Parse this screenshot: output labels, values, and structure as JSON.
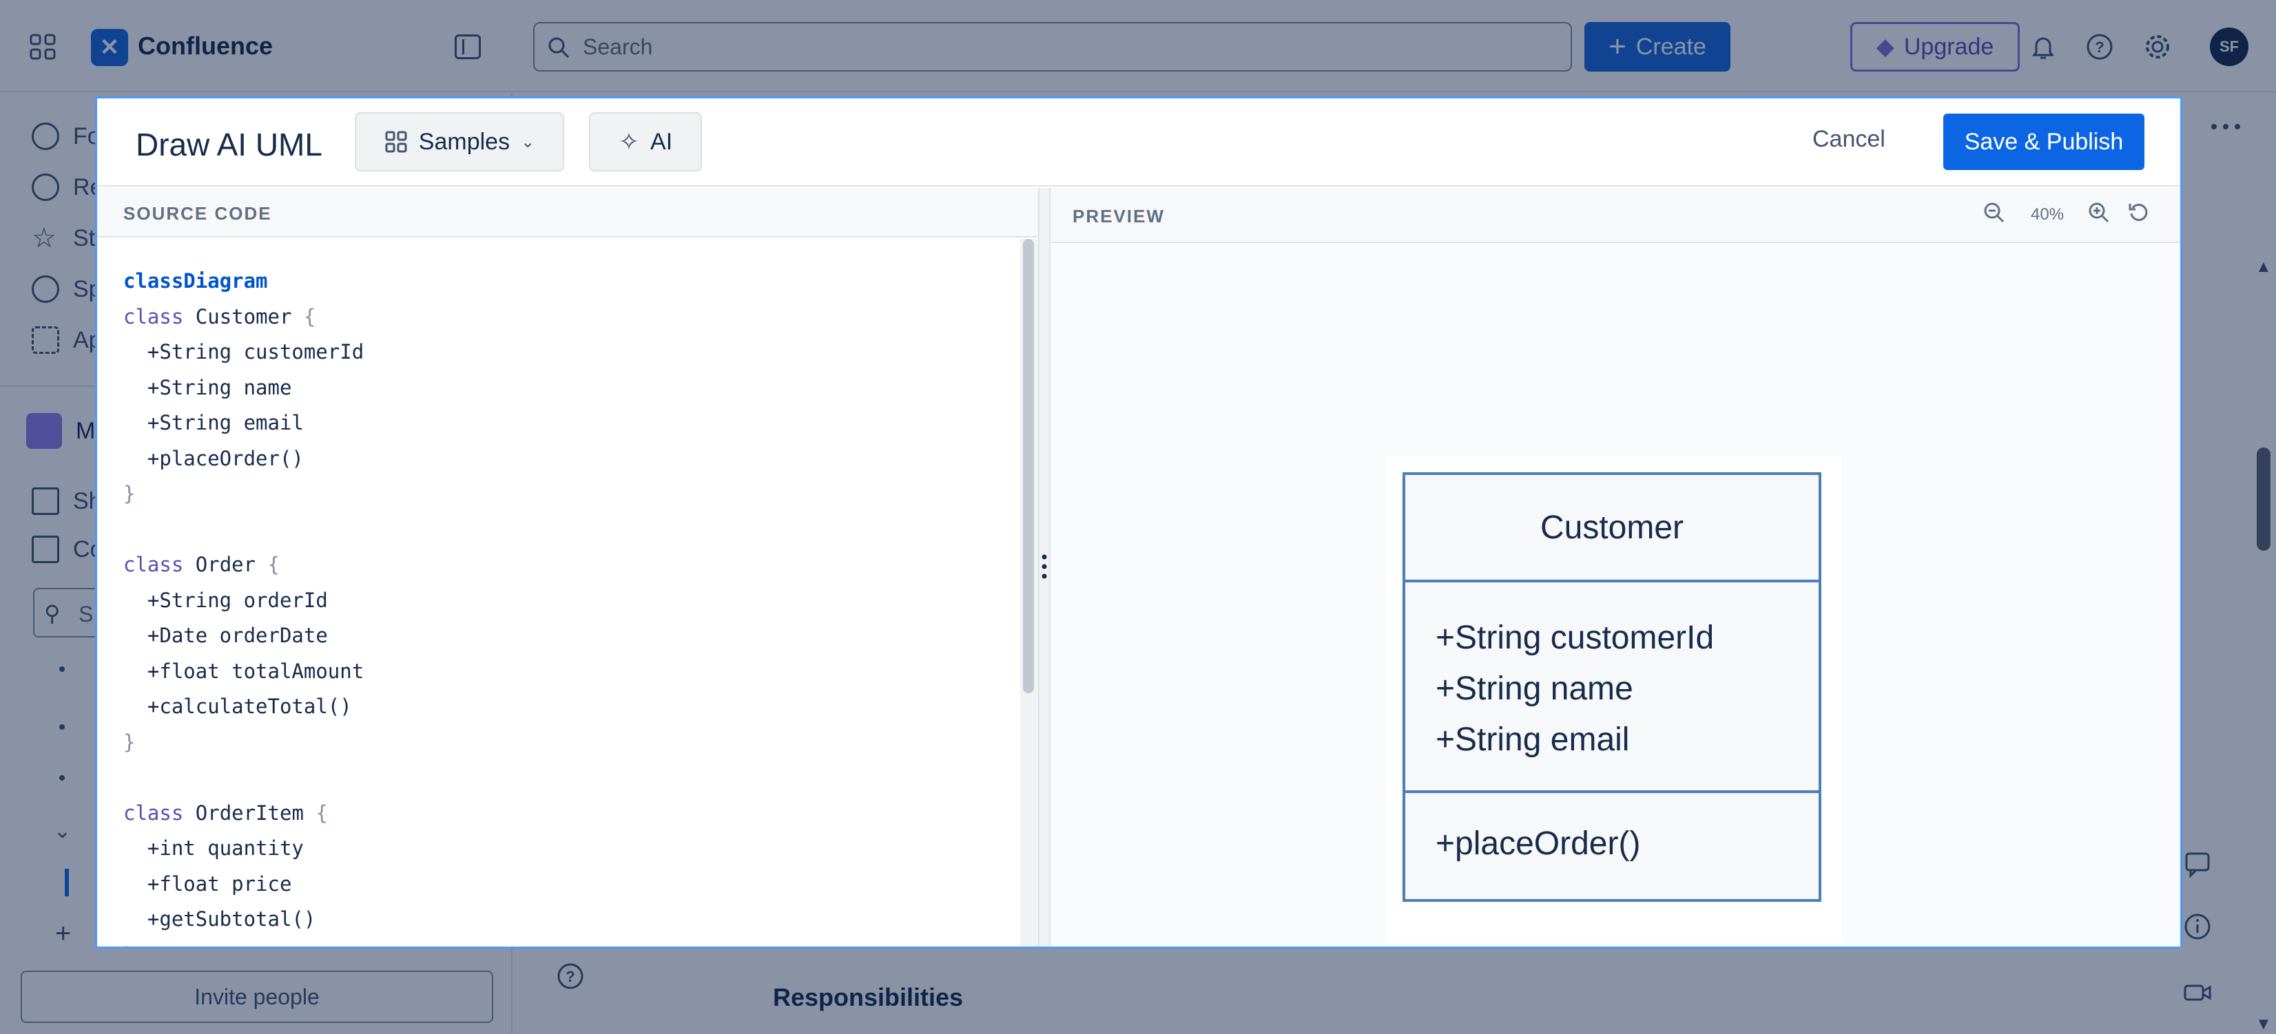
{
  "app": {
    "name": "Confluence",
    "search_placeholder": "Search",
    "create_label": "Create",
    "upgrade_label": "Upgrade",
    "avatar_initials": "SF",
    "brand_color": "#1868db"
  },
  "sidebar": {
    "items": [
      {
        "label": "Fo",
        "icon": "person-circle-icon"
      },
      {
        "label": "Re",
        "icon": "clock-icon"
      },
      {
        "label": "St",
        "icon": "star-icon"
      },
      {
        "label": "Sp",
        "icon": "planet-icon"
      },
      {
        "label": "Ap",
        "icon": "apps-icon"
      }
    ],
    "space_label": "Ma",
    "space_items": [
      {
        "label": "Sh",
        "icon": "shortcut-add-icon"
      },
      {
        "label": "Co",
        "icon": "content-icon"
      }
    ],
    "search_placeholder": "S",
    "invite_label": "Invite people"
  },
  "page": {
    "heading": "Responsibilities"
  },
  "modal": {
    "title": "Draw AI UML",
    "samples_label": "Samples",
    "ai_label": "AI",
    "cancel_label": "Cancel",
    "save_label": "Save & Publish",
    "source_label": "SOURCE CODE",
    "preview_label": "PREVIEW",
    "zoom": "40%",
    "code_lines": [
      "classDiagram",
      "class Customer {",
      "  +String customerId",
      "  +String name",
      "  +String email",
      "  +placeOrder()",
      "}",
      "",
      "class Order {",
      "  +String orderId",
      "  +Date orderDate",
      "  +float totalAmount",
      "  +calculateTotal()",
      "}",
      "",
      "class OrderItem {",
      "  +int quantity",
      "  +float price",
      "  +getSubtotal()",
      "}"
    ],
    "uml": {
      "class_name": "Customer",
      "attributes": [
        "+String customerId",
        "+String name",
        "+String email"
      ],
      "methods": [
        "+placeOrder()"
      ]
    }
  }
}
